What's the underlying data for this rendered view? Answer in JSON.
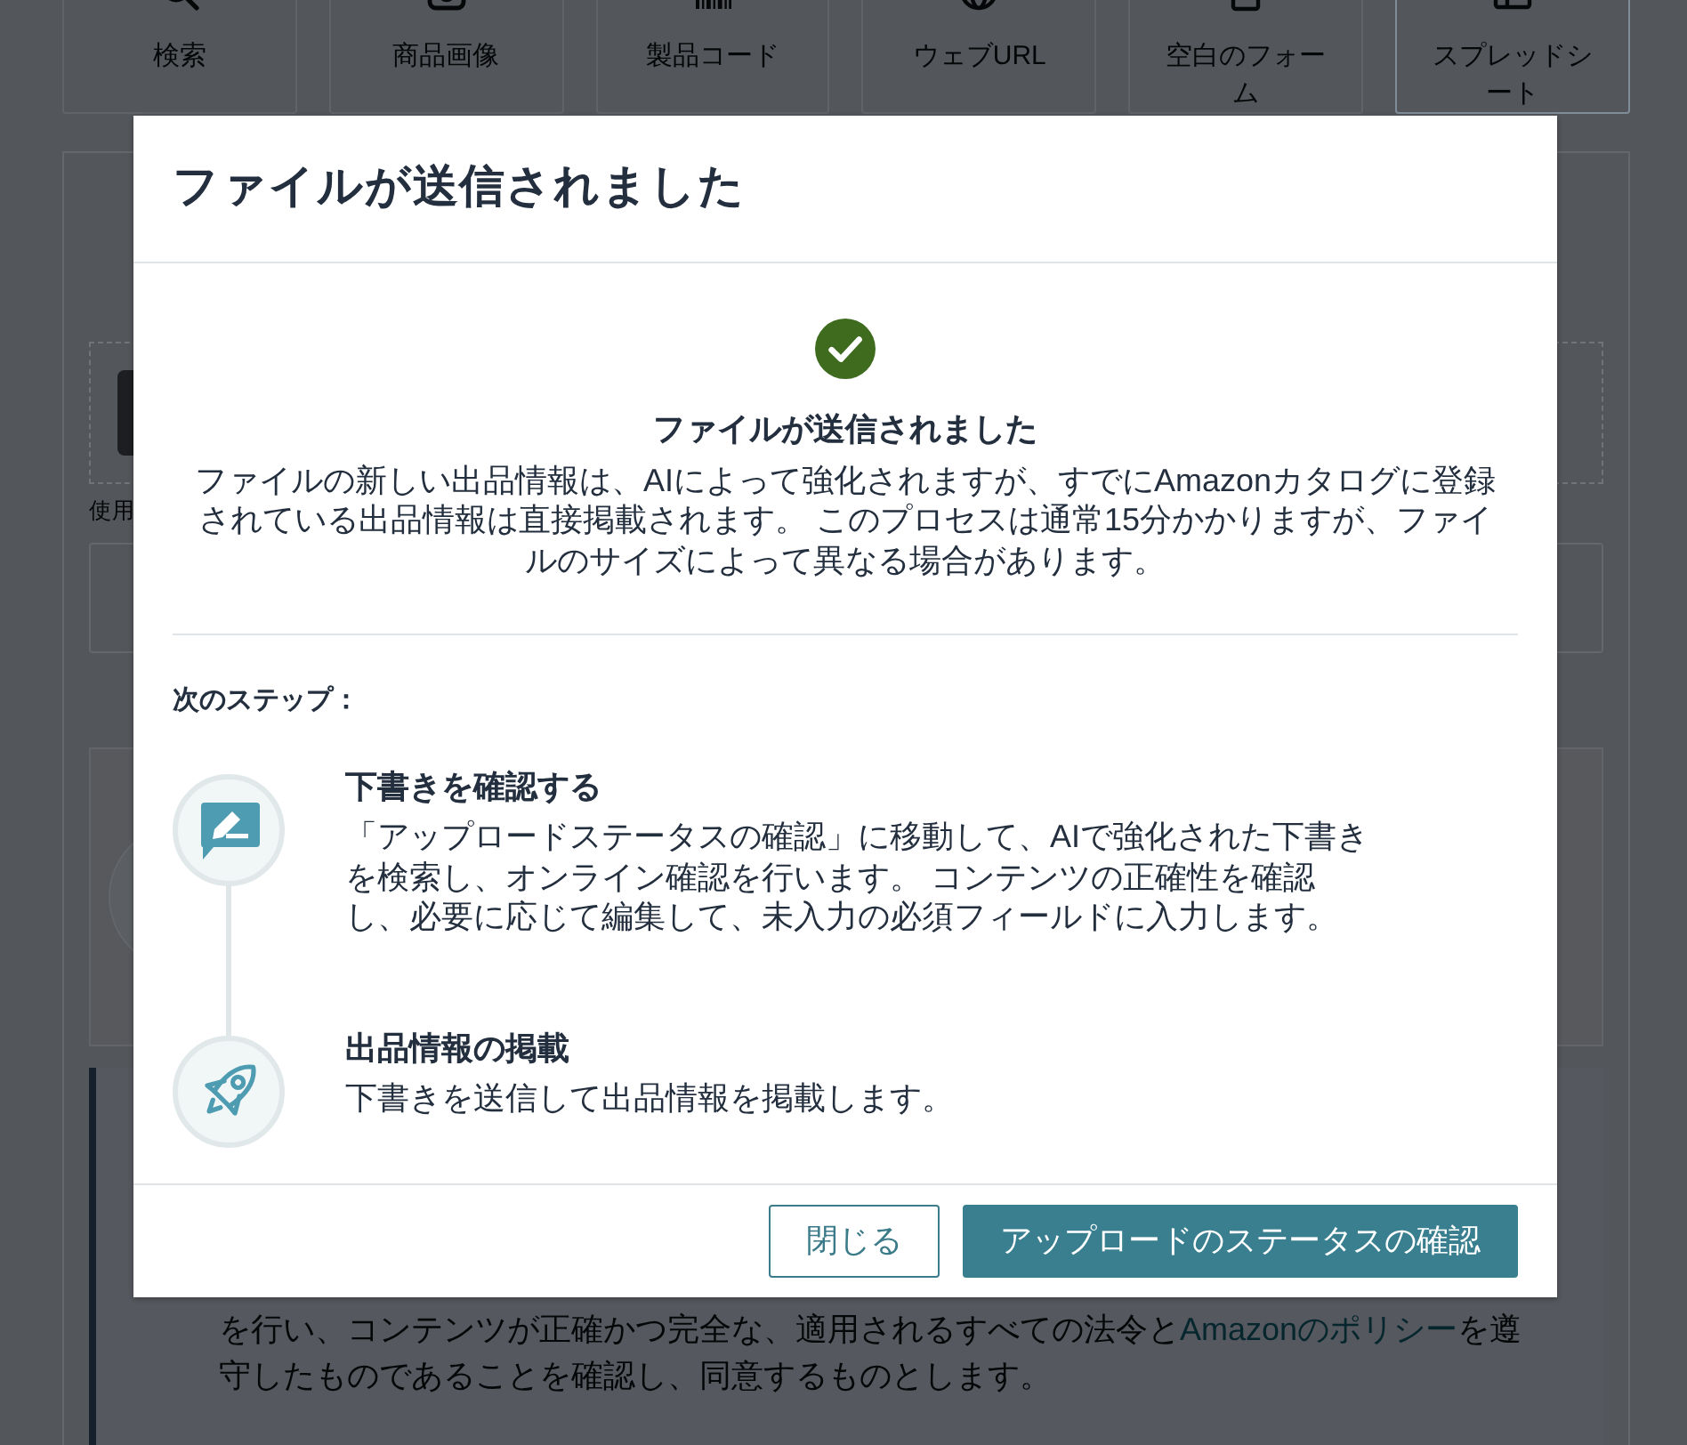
{
  "upload_methods": [
    {
      "kind": "search",
      "label": "検索",
      "selected": false
    },
    {
      "kind": "image",
      "label": "商品画像",
      "selected": false
    },
    {
      "kind": "barcode",
      "label": "製品コード",
      "selected": false
    },
    {
      "kind": "web",
      "label": "ウェブURL",
      "selected": false
    },
    {
      "kind": "form",
      "label": "空白のフォーム",
      "selected": false
    },
    {
      "kind": "spreadsheet",
      "label": "スプレッドシート",
      "selected": true
    }
  ],
  "panel": {
    "field_label": "使用",
    "notice": {
      "text_before": "を行い、コンテンツが正確かつ完全な、適用されるすべての法令と",
      "link": "Amazonのポリシー",
      "text_after": "を遵守したものであることを確認し、同意するものとします。"
    }
  },
  "dialog": {
    "title": "ファイルが送信されました",
    "status": {
      "kind": "success",
      "heading": "ファイルが送信されました",
      "message": "ファイルの新しい出品情報は、AIによって強化されますが、すでにAmazonカタログに登録されている出品情報は直接掲載されます。 このプロセスは通常15分かかりますが、ファイルのサイズによって異なる場合があります。"
    },
    "next_steps_label": "次のステップ：",
    "steps": [
      {
        "kind": "review",
        "title": "下書きを確認する",
        "description": "「アップロードステータスの確認」に移動して、AIで強化された下書きを検索し、オンライン確認を行います。 コンテンツの正確性を確認し、必要に応じて編集して、未入力の必須フィールドに入力します。"
      },
      {
        "kind": "publish",
        "title": "出品情報の掲載",
        "description": "下書きを送信して出品情報を掲載します。"
      }
    ],
    "buttons": [
      {
        "kind": "secondary",
        "label": "閉じる"
      },
      {
        "kind": "primary",
        "label": "アップロードのステータスの確認"
      }
    ]
  }
}
